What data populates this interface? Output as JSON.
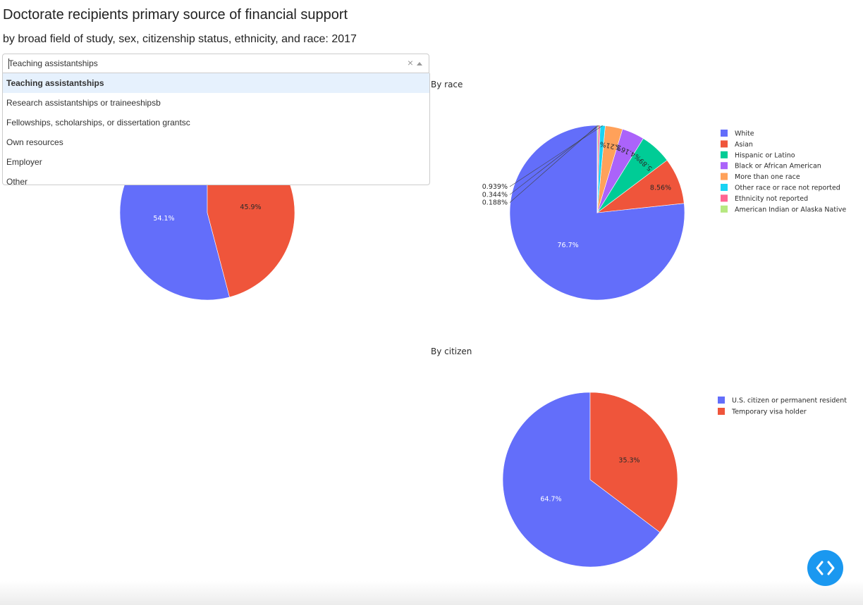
{
  "header": {
    "title": "Doctorate recipients primary source of financial support",
    "subtitle": "by broad field of study, sex, citizenship status, ethnicity, and race: 2017"
  },
  "dropdown": {
    "value": "Teaching assistantships",
    "clear_glyph": "×",
    "options": [
      "Teaching assistantships",
      "Research assistantships or traineeshipsb",
      "Fellowships, scholarships, or dissertation grantsc",
      "Own resources",
      "Employer",
      "Other"
    ],
    "selected_index": 0
  },
  "fab": {
    "icon": "code-icon"
  },
  "chart_data": [
    {
      "type": "pie",
      "title": "",
      "labels": [
        "",
        ""
      ],
      "values": [
        54.1,
        45.9
      ],
      "slice_labels": [
        "54.1%",
        "45.9%"
      ],
      "colors": [
        "#636efa",
        "#ef553b"
      ]
    },
    {
      "type": "pie",
      "title": "By race",
      "labels": [
        "White",
        "Asian",
        "Hispanic or Latino",
        "Black or African American",
        "More than one race",
        "Other race or race not reported",
        "Ethnicity not reported",
        "American Indian or Alaska Native"
      ],
      "values": [
        76.7,
        8.56,
        5.89,
        4.16,
        3.21,
        0.939,
        0.344,
        0.188
      ],
      "slice_labels": [
        "76.7%",
        "8.56%",
        "5.89%",
        "4.16%",
        "3.21%",
        "0.939%",
        "0.344%",
        "0.188%"
      ],
      "colors": [
        "#636efa",
        "#ef553b",
        "#00cc96",
        "#ab63fa",
        "#ffa15a",
        "#19d3f3",
        "#ff6692",
        "#b6e880"
      ]
    },
    {
      "type": "pie",
      "title": "By citizen",
      "labels": [
        "U.S. citizen or permanent resident",
        "Temporary visa holder"
      ],
      "values": [
        64.7,
        35.3
      ],
      "slice_labels": [
        "64.7%",
        "35.3%"
      ],
      "colors": [
        "#636efa",
        "#ef553b"
      ]
    }
  ]
}
